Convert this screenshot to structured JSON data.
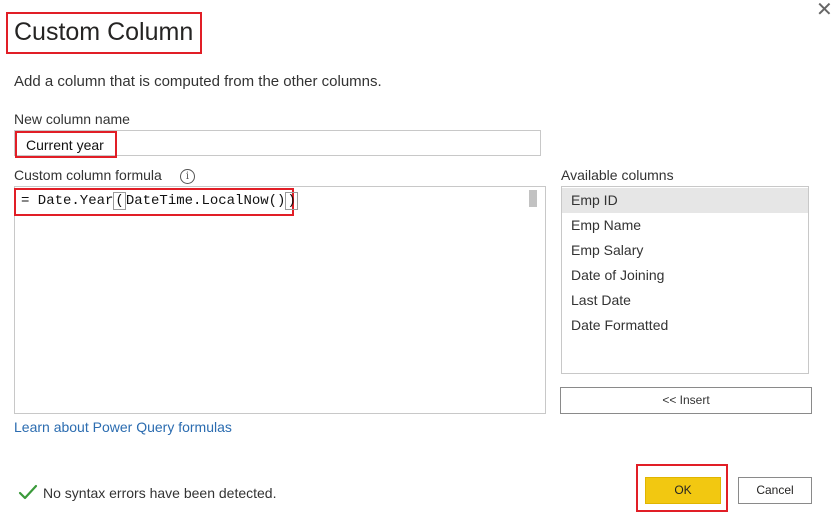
{
  "dialog": {
    "title": "Custom Column",
    "subtitle": "Add a column that is computed from the other columns.",
    "close_icon": "close-icon"
  },
  "new_column": {
    "label": "New column name",
    "value": "Current year"
  },
  "formula": {
    "label": "Custom column formula",
    "info_icon": "info-icon",
    "prefix": "= Date.Year",
    "open_paren": "(",
    "middle": "DateTime.LocalNow()",
    "close_paren": ")"
  },
  "available_columns": {
    "label": "Available columns",
    "items": [
      {
        "label": "Emp ID",
        "selected": true
      },
      {
        "label": "Emp Name",
        "selected": false
      },
      {
        "label": "Emp Salary",
        "selected": false
      },
      {
        "label": "Date of Joining",
        "selected": false
      },
      {
        "label": "Last Date",
        "selected": false
      },
      {
        "label": "Date Formatted",
        "selected": false
      }
    ],
    "insert_label": "<< Insert"
  },
  "learn_link": "Learn about Power Query formulas",
  "status": {
    "icon": "checkmark-icon",
    "text": "No syntax errors have been detected."
  },
  "buttons": {
    "ok": "OK",
    "cancel": "Cancel"
  },
  "colors": {
    "highlight": "#e11e26",
    "ok_button": "#f2c811",
    "link": "#2b6cb0",
    "success": "#3a9a3a"
  }
}
